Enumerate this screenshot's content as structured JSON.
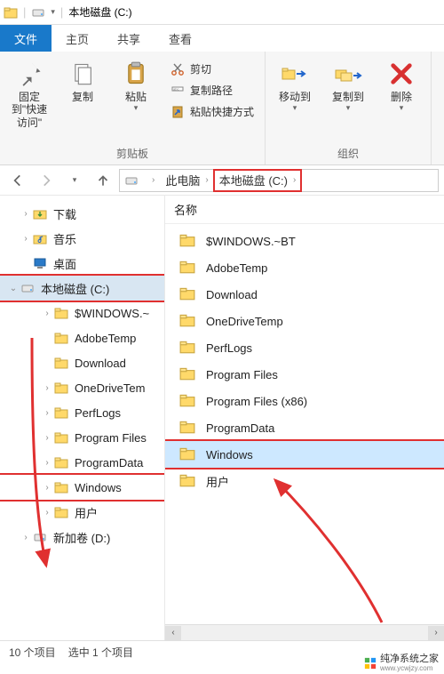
{
  "window": {
    "title": "本地磁盘 (C:)"
  },
  "tabs": {
    "file": "文件",
    "home": "主页",
    "share": "共享",
    "view": "查看"
  },
  "ribbon": {
    "clipboard_group": "剪贴板",
    "org_group": "组织",
    "pin": "固定到\"快速访问\"",
    "copy": "复制",
    "paste": "粘贴",
    "cut": "剪切",
    "copy_path": "复制路径",
    "paste_shortcut": "粘贴快捷方式",
    "move_to": "移动到",
    "copy_to": "复制到",
    "delete": "删除"
  },
  "breadcrumb": {
    "this_pc": "此电脑",
    "drive": "本地磁盘 (C:)"
  },
  "col": {
    "name": "名称"
  },
  "tree": {
    "downloads": "下载",
    "music": "音乐",
    "desktop": "桌面",
    "drive_c": "本地磁盘 (C:)",
    "windows_bt": "$WINDOWS.~",
    "adobe": "AdobeTemp",
    "download": "Download",
    "onedrive": "OneDriveTem",
    "perflogs": "PerfLogs",
    "program_files": "Program Files",
    "program_data": "ProgramData",
    "windows": "Windows",
    "users": "用户",
    "drive_d": "新加卷 (D:)"
  },
  "list": {
    "windows_bt": "$WINDOWS.~BT",
    "adobe": "AdobeTemp",
    "download": "Download",
    "onedrive": "OneDriveTemp",
    "perflogs": "PerfLogs",
    "program_files": "Program Files",
    "program_files_x86": "Program Files (x86)",
    "program_data": "ProgramData",
    "windows": "Windows",
    "users": "用户"
  },
  "status": {
    "items": "10 个项目",
    "selected": "选中 1 个项目"
  },
  "watermark": {
    "text": "纯净系统之家",
    "url": "www.ycwjzy.com"
  }
}
